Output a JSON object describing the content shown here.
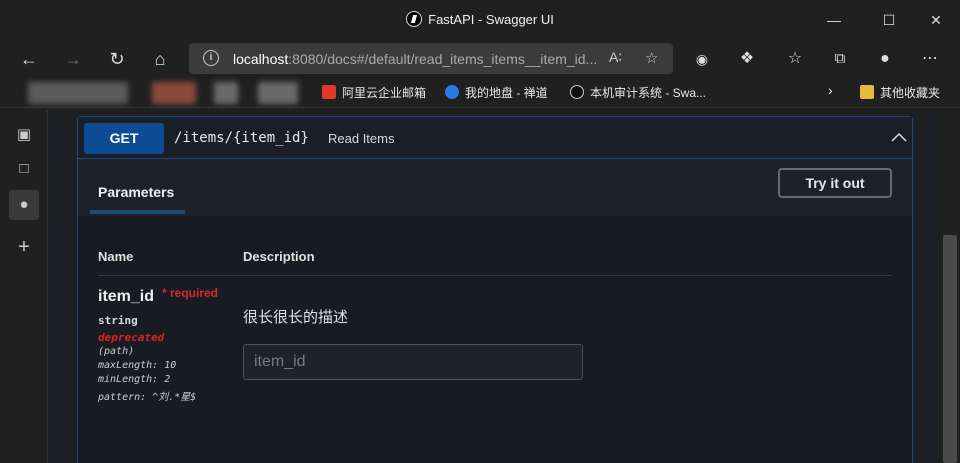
{
  "window": {
    "title": "FastAPI - Swagger UI",
    "controls": {
      "minimize": "—",
      "maximize": "☐",
      "close": "✕"
    }
  },
  "nav": {
    "url_host": "localhost",
    "url_rest": ":8080/docs#/default/read_items_items__item_id...",
    "icons": {
      "back": "back-arrow-icon",
      "forward": "forward-arrow-icon",
      "refresh": "refresh-icon",
      "home": "home-icon"
    }
  },
  "bookmarks": [
    {
      "label": "阿里云企业邮箱",
      "icon_color": "#e03a2f"
    },
    {
      "label": "我的地盘 - 禅道",
      "icon_color": "#2a7ae2"
    },
    {
      "label": "本机审计系统 - Swa...",
      "icon_color": "#111111"
    }
  ],
  "bookmarks_other": "其他收藏夹",
  "operation": {
    "method": "GET",
    "path": "/items/{item_id}",
    "summary": "Read Items",
    "method_color": "#0d4c94"
  },
  "tabs": {
    "parameters": "Parameters",
    "try_it_out": "Try it out"
  },
  "params_table": {
    "col_name": "Name",
    "col_description": "Description",
    "param": {
      "name": "item_id",
      "required_mark": "* required",
      "type": "string",
      "deprecated": "deprecated",
      "in": "(path)",
      "maxLength": "maxLength: 10",
      "minLength": "minLength: 2",
      "pattern": "pattern: ^刘.*星$",
      "description": "很长很长的描述",
      "input_placeholder": "item_id"
    }
  }
}
